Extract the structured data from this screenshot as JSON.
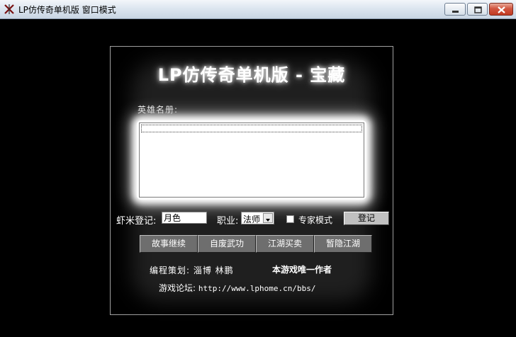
{
  "window": {
    "title": "LP仿传奇单机版 窗口模式"
  },
  "panel": {
    "title": "LP仿传奇单机版 - 宝藏",
    "roster_label": "英雄名册:",
    "roster_items": [
      ""
    ],
    "name_label": "虾米登记:",
    "name_value": "月色",
    "job_label": "职业:",
    "job_value": "法师",
    "expert_mode_label": "专家模式",
    "expert_mode_checked": false,
    "register_button": "登记",
    "actions": [
      "故事继续",
      "自废武功",
      "江湖买卖",
      "暂隐江湖"
    ],
    "credit": "编程策划: 淄博 林鹏",
    "slogan": "本游戏唯一作者",
    "forum_label": "游戏论坛:",
    "forum_url": "http://www.lphome.cn/bbs/"
  },
  "colors": {
    "background": "#000000",
    "button_face": "#6e6e6e",
    "text": "#ffffff"
  }
}
